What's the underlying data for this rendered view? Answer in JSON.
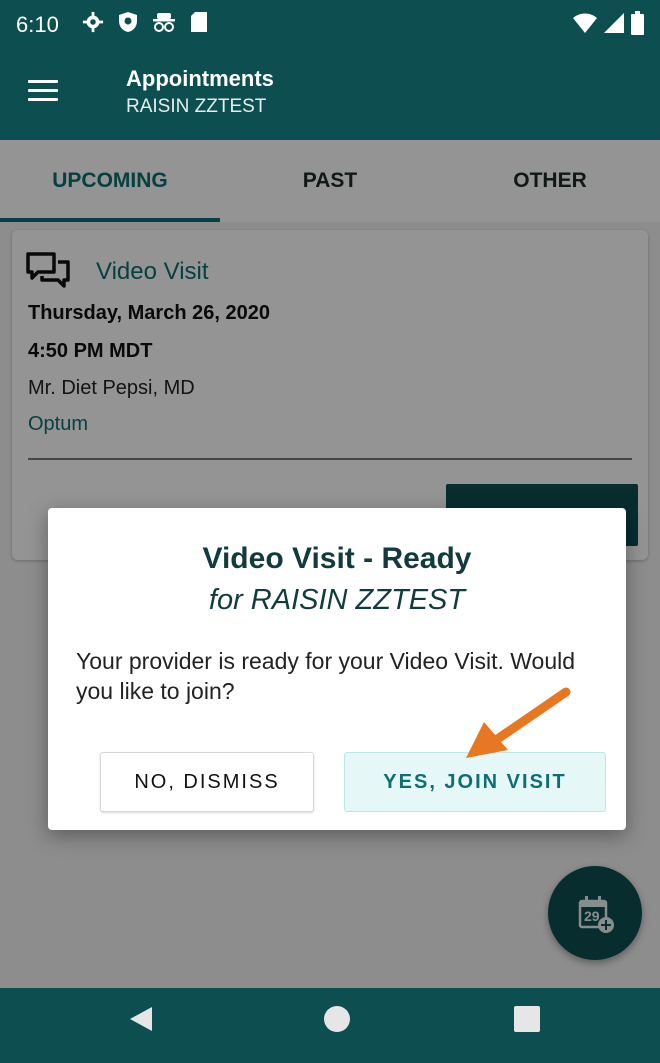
{
  "status_bar": {
    "time": "6:10",
    "left_icons": [
      "settings-icon",
      "shield-icon",
      "incognito-icon",
      "sd-card-icon"
    ],
    "right_icons": [
      "wifi-icon",
      "signal-icon",
      "battery-icon"
    ]
  },
  "app_bar": {
    "title": "Appointments",
    "subtitle": "RAISIN ZZTEST"
  },
  "tabs": [
    {
      "label": "UPCOMING",
      "active": true
    },
    {
      "label": "PAST",
      "active": false
    },
    {
      "label": "OTHER",
      "active": false
    }
  ],
  "appointment": {
    "type": "Video Visit",
    "date": "Thursday, March 26, 2020",
    "time": "4:50 PM MDT",
    "provider": "Mr. Diet Pepsi, MD",
    "organization": "Optum",
    "join_label": "JOIN VISIT"
  },
  "dialog": {
    "title": "Video Visit - Ready",
    "subtitle": "for RAISIN ZZTEST",
    "body": "Your provider is ready for your Video Visit. Would you like to join?",
    "dismiss_label": "NO, DISMISS",
    "join_label": "YES, JOIN VISIT"
  },
  "fab": {
    "icon": "calendar-add-icon",
    "day": "29"
  },
  "colors": {
    "primary": "#0d4f51",
    "accent": "#0d6f72",
    "arrow": "#e87722"
  }
}
